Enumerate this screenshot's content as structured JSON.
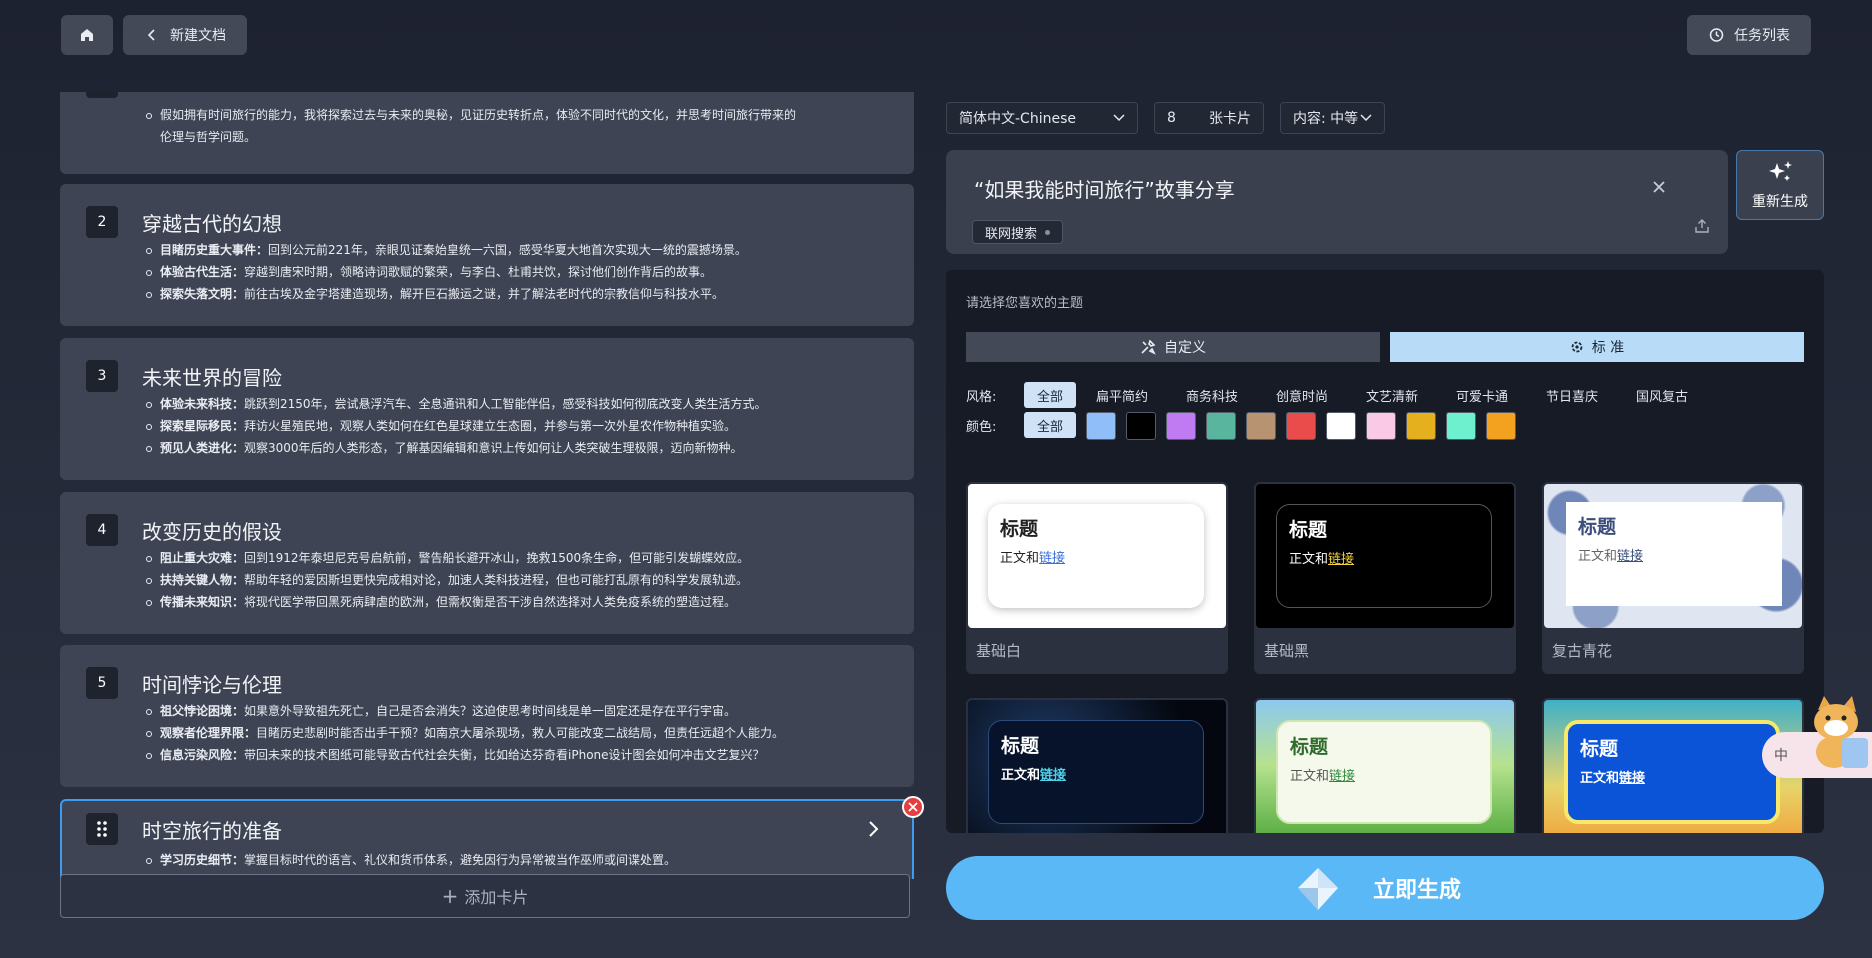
{
  "topbar": {
    "new_doc": "新建文档",
    "task_list": "任务列表"
  },
  "cards": [
    {
      "title": "",
      "items": [
        {
          "b": "",
          "t": "假如拥有时间旅行的能力，我将探索过去与未来的奥秘，见证历史转折点，体验不同时代的文化，并思考时间旅行带来的"
        },
        {
          "b": "",
          "t": "伦理与哲学问题。"
        }
      ]
    },
    {
      "num": "2",
      "title": "穿越古代的幻想",
      "items": [
        {
          "b": "目睹历史重大事件：",
          "t": "回到公元前221年，亲眼见证秦始皇统一六国，感受华夏大地首次实现大一统的震撼场景。"
        },
        {
          "b": "体验古代生活：",
          "t": "穿越到唐宋时期，领略诗词歌赋的繁荣，与李白、杜甫共饮，探讨他们创作背后的故事。"
        },
        {
          "b": "探索失落文明：",
          "t": "前往古埃及金字塔建造现场，解开巨石搬运之谜，并了解法老时代的宗教信仰与科技水平。"
        }
      ]
    },
    {
      "num": "3",
      "title": "未来世界的冒险",
      "items": [
        {
          "b": "体验未来科技：",
          "t": "跳跃到2150年，尝试悬浮汽车、全息通讯和人工智能伴侣，感受科技如何彻底改变人类生活方式。"
        },
        {
          "b": "探索星际移民：",
          "t": "拜访火星殖民地，观察人类如何在红色星球建立生态圈，并参与第一次外星农作物种植实验。"
        },
        {
          "b": "预见人类进化：",
          "t": "观察3000年后的人类形态，了解基因编辑和意识上传如何让人类突破生理极限，迈向新物种。"
        }
      ]
    },
    {
      "num": "4",
      "title": "改变历史的假设",
      "items": [
        {
          "b": "阻止重大灾难：",
          "t": "回到1912年泰坦尼克号启航前，警告船长避开冰山，挽救1500条生命，但可能引发蝴蝶效应。"
        },
        {
          "b": "扶持关键人物：",
          "t": "帮助年轻的爱因斯坦更快完成相对论，加速人类科技进程，但也可能打乱原有的科学发展轨迹。"
        },
        {
          "b": "传播未来知识：",
          "t": "将现代医学带回黑死病肆虐的欧洲，但需权衡是否干涉自然选择对人类免疫系统的塑造过程。"
        }
      ]
    },
    {
      "num": "5",
      "title": "时间悖论与伦理",
      "items": [
        {
          "b": "祖父悖论困境：",
          "t": "如果意外导致祖先死亡，自己是否会消失？这迫使思考时间线是单一固定还是存在平行宇宙。"
        },
        {
          "b": "观察者伦理界限：",
          "t": "目睹历史悲剧时能否出手干预？如南京大屠杀现场，救人可能改变二战结局，但责任远超个人能力。"
        },
        {
          "b": "信息污染风险：",
          "t": "带回未来的技术图纸可能导致古代社会失衡，比如给达芬奇看iPhone设计图会如何冲击文艺复兴？"
        }
      ]
    },
    {
      "num": "",
      "title": "时空旅行的准备",
      "items": [
        {
          "b": "学习历史细节：",
          "t": "掌握目标时代的语言、礼仪和货币体系，避免因行为异常被当作巫师或间谍处置。"
        }
      ]
    }
  ],
  "add_card": "添加卡片",
  "options": {
    "language": "简体中文-Chinese",
    "card_count": "8",
    "card_unit": "张卡片",
    "content": "内容: 中等"
  },
  "prompt": {
    "text": "“如果我能时间旅行”故事分享",
    "web_search": "联网搜索"
  },
  "regen": "重新生成",
  "theme_panel": {
    "heading": "请选择您喜欢的主题",
    "tab_custom": "自定义",
    "tab_standard": "标 准",
    "style_label": "风格:",
    "styles": [
      "全部",
      "扁平简约",
      "商务科技",
      "创意时尚",
      "文艺清新",
      "可爱卡通",
      "节日喜庆",
      "国风复古"
    ],
    "color_label": "颜色:",
    "color_all": "全部",
    "colors": [
      "#8fbef8",
      "#000000",
      "#c07bf2",
      "#5ab59e",
      "#b89372",
      "#ea4b4b",
      "#ffffff",
      "#f9c9e6",
      "#e4b01e",
      "#6ef0cf",
      "#f3a21f"
    ],
    "preview_title": "标题",
    "preview_body": "正文和",
    "preview_link": "链接",
    "themes": [
      "基础白",
      "基础黑",
      "复古青花",
      "",
      "",
      ""
    ]
  },
  "generate": "立即生成",
  "ime": "中"
}
